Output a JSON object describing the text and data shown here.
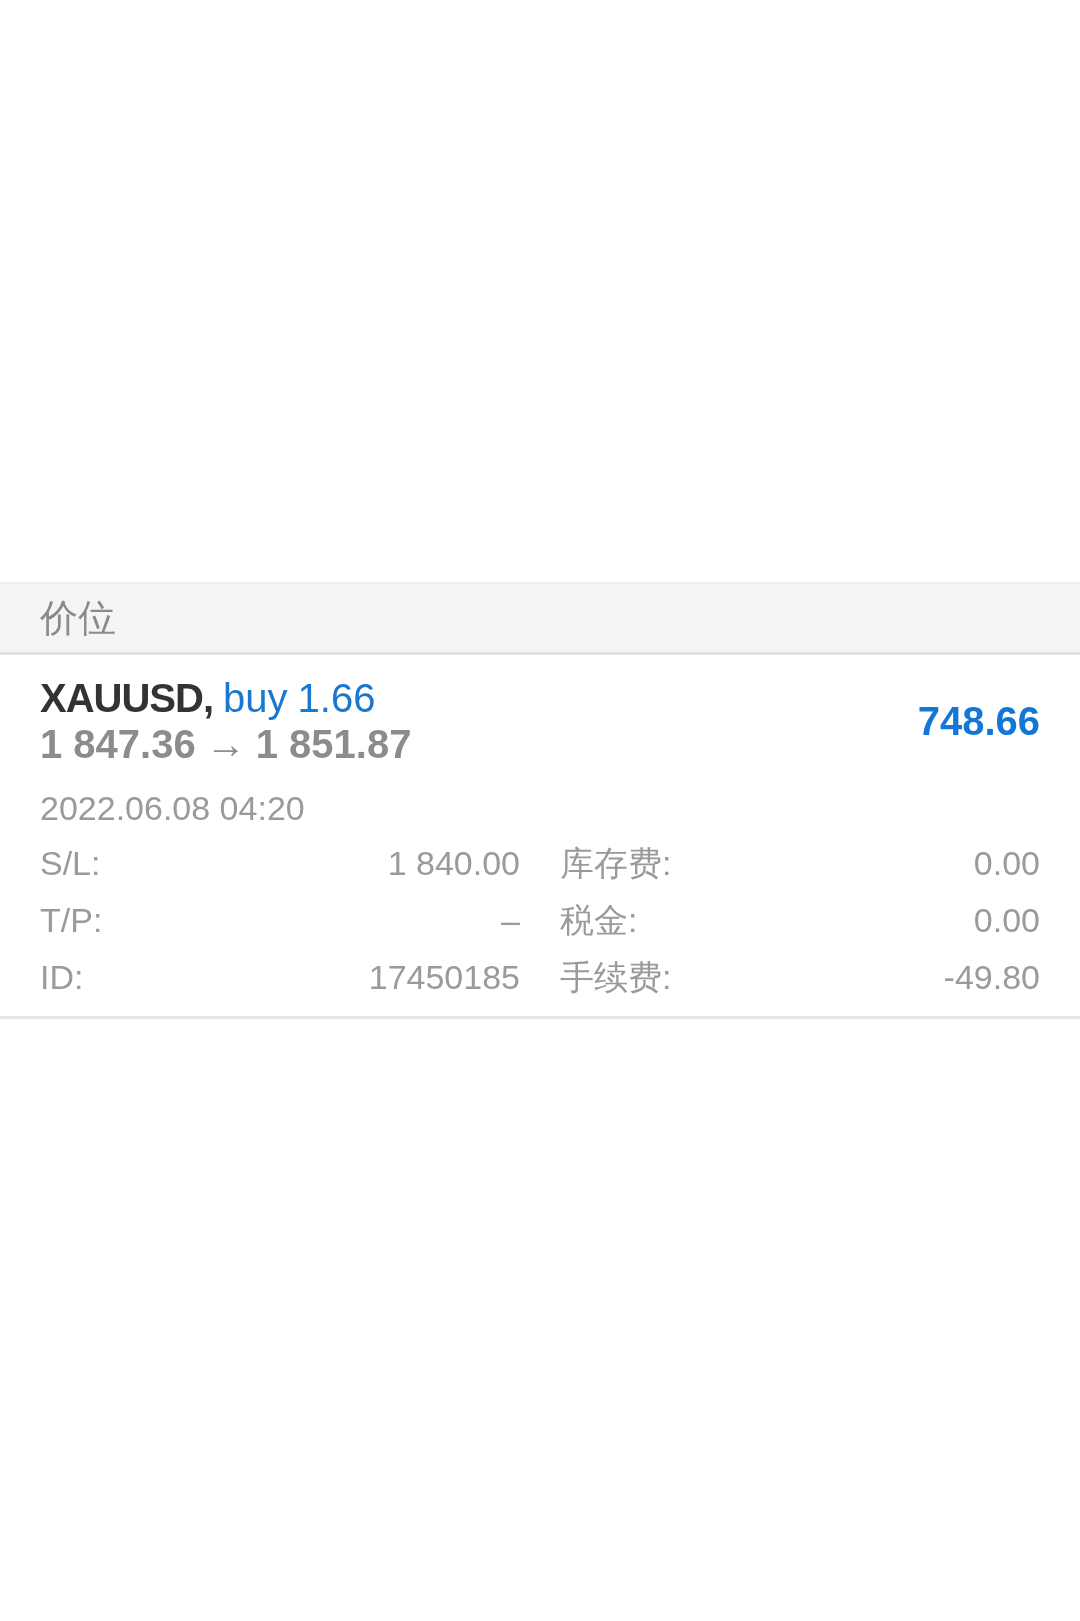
{
  "section_header": "价位",
  "position": {
    "symbol": "XAUUSD,",
    "direction": "buy",
    "volume": "1.66",
    "open_price": "1 847.36",
    "arrow": "→",
    "current_price": "1 851.87",
    "profit": "748.66",
    "time": "2022.06.08 04:20",
    "details": [
      {
        "label": "S/L:",
        "value": "1 840.00"
      },
      {
        "label": "库存费:",
        "value": "0.00"
      },
      {
        "label": "T/P:",
        "value": "–"
      },
      {
        "label": "税金:",
        "value": "0.00"
      },
      {
        "label": "ID:",
        "value": "17450185"
      },
      {
        "label": "手续费:",
        "value": "-49.80"
      }
    ]
  }
}
